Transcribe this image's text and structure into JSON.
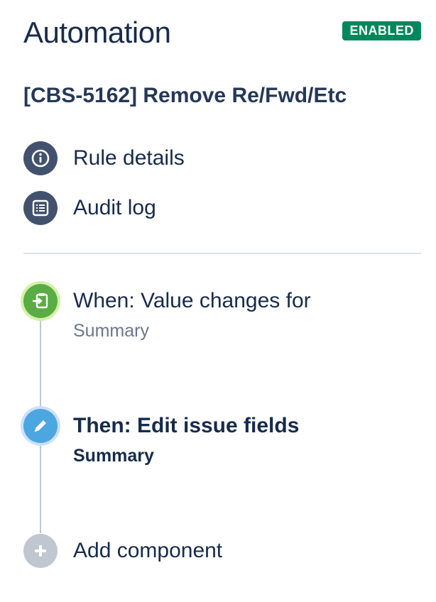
{
  "header": {
    "title": "Automation",
    "status": "ENABLED",
    "status_color": "#00875a"
  },
  "rule": {
    "name": "[CBS-5162] Remove Re/Fwd/Etc"
  },
  "nav": {
    "items": [
      {
        "label": "Rule details",
        "icon": "info-icon"
      },
      {
        "label": "Audit log",
        "icon": "list-icon"
      }
    ]
  },
  "flow": {
    "trigger": {
      "title": "When: Value changes for",
      "subtitle": "Summary",
      "icon": "trigger-icon",
      "color": "#5aac44"
    },
    "action": {
      "title": "Then: Edit issue fields",
      "subtitle": "Summary",
      "icon": "pencil-icon",
      "color": "#4ca6e0"
    },
    "add": {
      "label": "Add component",
      "icon": "plus-icon"
    }
  }
}
